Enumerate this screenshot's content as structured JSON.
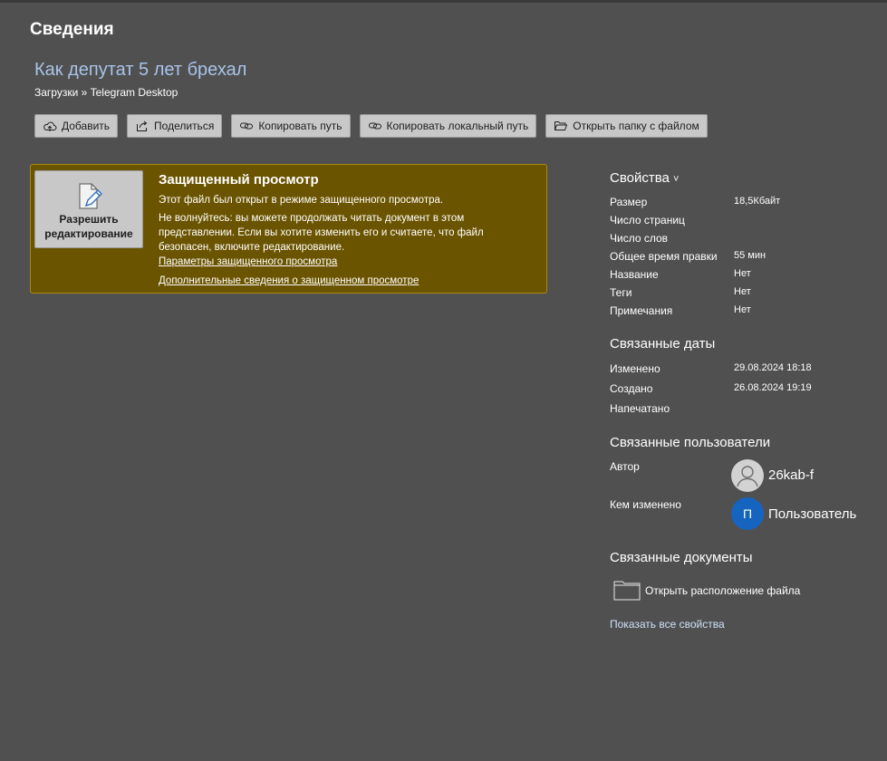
{
  "header": {
    "page_title": "Сведения",
    "doc_title": "Как депутат 5 лет брехал",
    "breadcrumb": "Загрузки » Telegram Desktop"
  },
  "toolbar": {
    "buttons": [
      {
        "label": "Добавить",
        "icon": "cloud-upload-icon"
      },
      {
        "label": "Поделиться",
        "icon": "share-icon"
      },
      {
        "label": "Копировать путь",
        "icon": "link-icon"
      },
      {
        "label": "Копировать локальный путь",
        "icon": "link-icon"
      },
      {
        "label": "Открыть папку с файлом",
        "icon": "folder-open-icon"
      }
    ]
  },
  "protected_view": {
    "enable_button": [
      "Разрешить",
      "редактирование"
    ],
    "title": "Защищенный просмотр",
    "line1": "Этот файл был открыт в режиме защищенного просмотра.",
    "line2": [
      "Не волнуйтесь: вы можете продолжать читать документ в этом",
      "представлении. Если вы хотите изменить его и считаете, что файл",
      "безопасен, включите редактирование."
    ],
    "link1": "Параметры защищенного просмотра",
    "link2": "Дополнительные сведения о защищенном просмотре",
    "colors": {
      "background": "#6b5400",
      "border": "#a98a10"
    }
  },
  "properties": {
    "title": "Свойства",
    "chevron": "˅",
    "rows": [
      {
        "label": "Размер",
        "value": "18,5Кбайт"
      },
      {
        "label": "Число страниц",
        "value": ""
      },
      {
        "label": "Число слов",
        "value": ""
      },
      {
        "label": "Общее время правки",
        "value": "55 мин"
      },
      {
        "label": "Название",
        "value": "Нет"
      },
      {
        "label": "Теги",
        "value": "Нет"
      },
      {
        "label": "Примечания",
        "value": "Нет"
      }
    ]
  },
  "dates": {
    "title": "Связанные даты",
    "rows": [
      {
        "label": "Изменено",
        "value": "29.08.2024 18:18"
      },
      {
        "label": "Создано",
        "value": "26.08.2024 19:19"
      },
      {
        "label": "Напечатано",
        "value": ""
      }
    ]
  },
  "people": {
    "title": "Связанные пользователи",
    "author_label": "Автор",
    "author_name": "26kab-f",
    "modifier_label": "Кем изменено",
    "modifier_initial": "П",
    "modifier_name": "Пользователь",
    "modifier_color": "#1565c0"
  },
  "documents": {
    "title": "Связанные документы",
    "open_location": "Открыть расположение файла",
    "show_all": "Показать все свойства"
  }
}
